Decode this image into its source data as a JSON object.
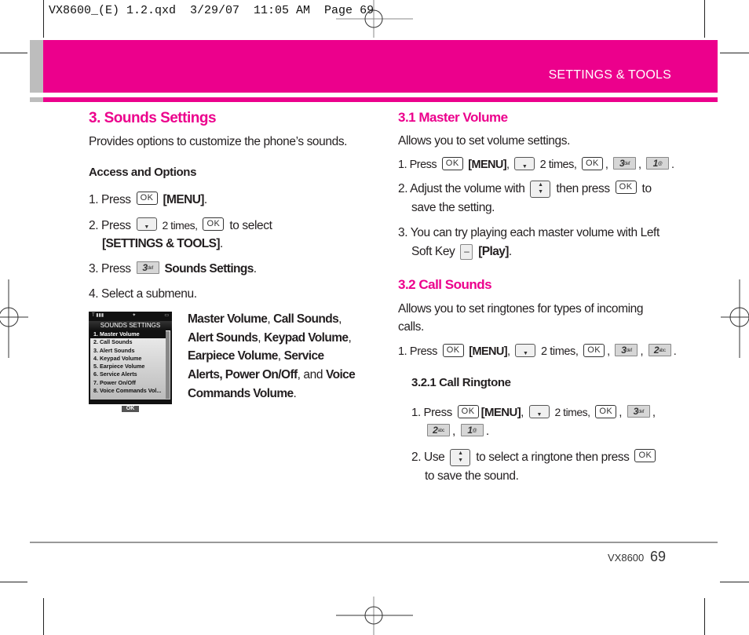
{
  "slug_line": "VX8600_(E) 1.2.qxd  3/29/07  11:05 AM  Page 69",
  "header": {
    "section_title": "SETTINGS & TOOLS",
    "accent_color": "#ec008c",
    "tab_color": "#bdbdbd"
  },
  "left": {
    "title": "3. Sounds Settings",
    "intro": "Provides options to customize the phone’s sounds.",
    "access_heading": "Access and Options",
    "steps": [
      {
        "num": "1. Press",
        "key1": "OK",
        "bold": "[MENU]",
        "tail": "."
      },
      {
        "num": "2. Press",
        "text1": "2 times,",
        "key2": "OK",
        "text2": "to select",
        "bold": "[SETTINGS & TOOLS]",
        "tail": "."
      },
      {
        "num": "3. Press",
        "key": "3",
        "key_sub": "def",
        "bold": "Sounds Settings",
        "tail": "."
      },
      {
        "num": "4. Select a submenu."
      }
    ],
    "submenu_desc": {
      "b1": "Master Volume",
      "s1": ", ",
      "b2": "Call Sounds",
      "s2": ",",
      "b3": "Alert Sounds",
      "s3": ", ",
      "b4": "Keypad Volume",
      "s4": ",",
      "b5": "Earpiece Volume",
      "s5": ", ",
      "b6": "Service",
      "b7": "Alerts, Power On/Off",
      "s7": ", and ",
      "b8": "Voice",
      "b9": "Commands Volume",
      "s9": "."
    },
    "phone_screen": {
      "title": "SOUNDS SETTINGS",
      "items": [
        "1. Master Volume",
        "2. Call Sounds",
        "3. Alert Sounds",
        "4. Keypad Volume",
        "5. Earpiece Volume",
        "6. Service Alerts",
        "7. Power On/Off",
        "8. Voice Commands Vol..."
      ],
      "selected_index": 0,
      "softkey": "OK"
    }
  },
  "right": {
    "master": {
      "title": "3.1 Master Volume",
      "intro": "Allows you to set volume settings.",
      "step1": {
        "num": "1.  Press",
        "ok": "OK",
        "bold": "[MENU]",
        "times": "2 times,",
        "k3": "3",
        "k3sub": "def",
        "k1": "1",
        "k1sub": "@"
      },
      "step2": {
        "a": "2.  Adjust the volume with",
        "b": "then press",
        "ok": "OK",
        "c": "to",
        "d": "save the setting."
      },
      "step3": {
        "a": "3. You can try playing each master volume with Left",
        "b": "Soft Key",
        "bold": "[Play]",
        "tail": "."
      }
    },
    "call": {
      "title": "3.2 Call Sounds",
      "intro1": "Allows you to set ringtones for types of incoming",
      "intro2": "calls.",
      "step1": {
        "num": "1.  Press",
        "ok": "OK",
        "bold": "[MENU]",
        "times": "2 times,",
        "k3": "3",
        "k3sub": "def",
        "k2": "2",
        "k2sub": "abc"
      },
      "ringtone": {
        "title": "3.2.1 Call Ringtone",
        "step1": {
          "num": "1.  Press",
          "ok": "OK",
          "bold": "[MENU]",
          "times": "2 times,",
          "k3": "3",
          "k3sub": "def",
          "k2": "2",
          "k2sub": "abc",
          "k1": "1",
          "k1sub": "@"
        },
        "step2": {
          "a": "2.  Use",
          "b": "to select a ringtone then press",
          "ok": "OK",
          "c": "to save the sound."
        }
      }
    }
  },
  "footer": {
    "model": "VX8600",
    "page": "69"
  }
}
